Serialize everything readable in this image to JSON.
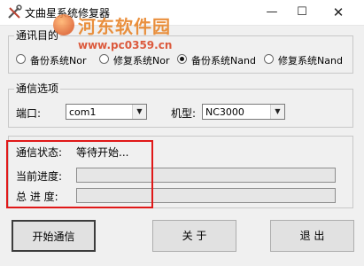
{
  "window": {
    "title": "文曲星系统修复器",
    "min_glyph": "—",
    "max_glyph": "☐",
    "close_glyph": "✕"
  },
  "watermark": {
    "text": "河东软件园",
    "url": "www.pc0359.cn"
  },
  "purpose_group": {
    "title": "通讯目的",
    "options": [
      "备份系统Nor",
      "修复系统Nor",
      "备份系统Nand",
      "修复系统Nand"
    ],
    "selected_index": 2
  },
  "options_group": {
    "title": "通信选项",
    "port_label": "端口:",
    "port_value": "com1",
    "model_label": "机型:",
    "model_value": "NC3000"
  },
  "status_group": {
    "status_label": "通信状态:",
    "status_value": "等待开始...",
    "current_progress_label": "当前进度:",
    "current_progress": 0,
    "total_progress_label": "总 进 度:",
    "total_progress": 0
  },
  "buttons": {
    "start": "开始通信",
    "about": "关 于",
    "exit": "退 出"
  }
}
